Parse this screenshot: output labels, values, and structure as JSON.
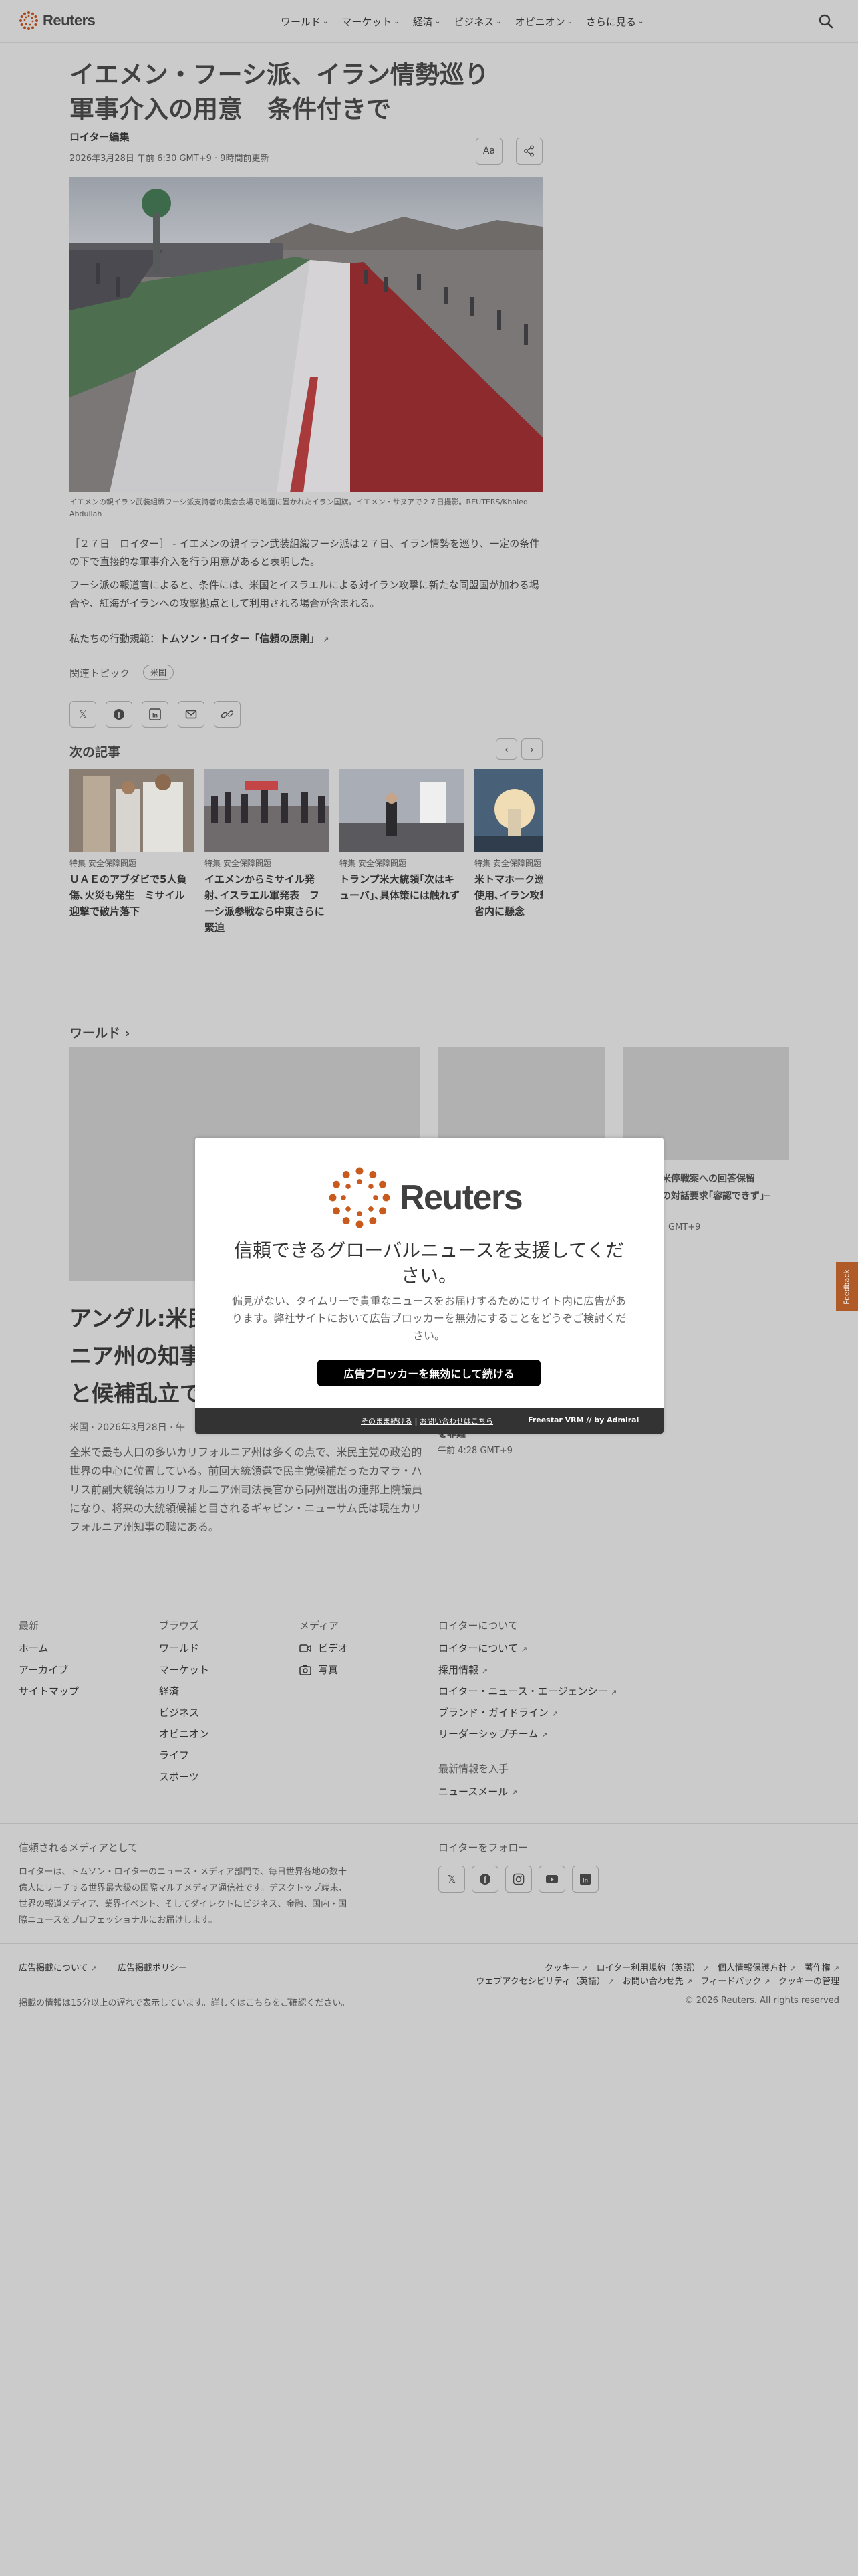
{
  "header": {
    "logo_text": "Reuters",
    "nav": [
      "ワールド",
      "マーケット",
      "経済",
      "ビジネス",
      "オピニオン",
      "さらに見る"
    ]
  },
  "article": {
    "headline_line1": "イエメン・フーシ派、イラン情勢巡り",
    "headline_line2": "軍事介入の用意　条件付きで",
    "byline": "ロイター編集",
    "dateline": "2026年3月28日 午前 6:30 GMT+9 · 9時間前更新",
    "text_size_button": "Aa",
    "caption": "イエメンの親イラン武装組織フーシ派支持者の集会会場で地面に置かれたイラン国旗。イエメン・サヌアで２７日撮影。REUTERS/Khaled Abdullah",
    "paragraph1": "［２７日　ロイター］ - イエメンの親イラン武装組織フーシ派は２７日、イラン情勢を巡り、一定の条件の下で直接的な軍事介入を行う用意があると表明した。",
    "paragraph2": "フーシ派の報道官によると、条件には、米国とイスラエルによる対イラン攻撃に新たな同盟国が加わる場合や、紅海がイランへの攻撃拠点として利用される場合が含まれる。",
    "ethics_prefix": "私たちの行動規範：",
    "ethics_link": "トムソン・ロイター「信頼の原則」",
    "topics_label": "関連トピック",
    "topic": "米国"
  },
  "next_articles": {
    "title": "次の記事",
    "cards": [
      {
        "kicker": "特集 安全保障問題",
        "title": "ＵＡＥのアブダビで5人負傷､火災も発生　ミサイル迎撃で破片落下"
      },
      {
        "kicker": "特集 安全保障問題",
        "title": "イエメンからミサイル発射､イスラエル軍発表　フーシ派参戦なら中東さらに緊迫"
      },
      {
        "kicker": "特集 安全保障問題",
        "title": "トランプ米大統領｢次はキューバ｣､具体策には触れず"
      },
      {
        "kicker": "特集 安全保障問題",
        "title": "米トマホーク巡航ミサイル使用､イラン攻撃で国防総省内に懸念"
      }
    ]
  },
  "world_section": {
    "label": "ワールド",
    "big_headline_visible": [
      "アングル:米民",
      "ニア州の知事",
      "と候補乱立で"
    ],
    "big_meta": "米国 · 2026年3月28日 · 午",
    "big_body": "全米で最も人口の多いカリフォルニア州は多くの点で、米民主党の政治的世界の中心に位置している。前回大統領選で民主党候補だったカマラ・ハリス前副大統領はカリフォルニア州司法長官から同州選出の連邦上院議員になり、将来の大統領候補と目されるギャビン・ニューサム氏は現在カリフォルニア州知事の職にある。",
    "side_title_1": "米停戦案への回答保留",
    "side_title_2": "の対話要求｢容認できず｣─",
    "side_time_1": "GMT+9",
    "side_word": "を非難",
    "side_time_2": "午前 4:28 GMT+9"
  },
  "modal": {
    "logo_text": "Reuters",
    "title": "信頼できるグローバルニュースを支援してください。",
    "body": "偏見がない、タイムリーで貴重なニュースをお届けするためにサイト内に広告があります。弊社サイトにおいて広告ブロッカーを無効にすることをどうぞご検討ください。",
    "cta": "広告ブロッカーを無効にして続ける",
    "foot_link1": "そのまま続ける",
    "foot_sep": "|",
    "foot_link2": "お問い合わせはこちら",
    "foot_brand": "Freestar VRM // by Admiral"
  },
  "feedback": "Feedback",
  "footer": {
    "col1": {
      "head": "最新",
      "links": [
        "ホーム",
        "アーカイブ",
        "サイトマップ"
      ]
    },
    "col2": {
      "head": "ブラウズ",
      "links": [
        "ワールド",
        "マーケット",
        "経済",
        "ビジネス",
        "オピニオン",
        "ライフ",
        "スポーツ"
      ]
    },
    "col3": {
      "head": "メディア",
      "links": [
        "ビデオ",
        "写真"
      ]
    },
    "col4": {
      "head": "ロイターについて",
      "links": [
        "ロイターについて",
        "採用情報",
        "ロイター・ニュース・エージェンシー",
        "ブランド・ガイドライン",
        "リーダーシップチーム"
      ]
    },
    "latest_head": "最新情報を入手",
    "newsletter": "ニュースメール",
    "trust_head": "信頼されるメディアとして",
    "trust_body": "ロイターは、トムソン・ロイターのニュース・メディア部門で、毎日世界各地の数十億人にリーチする世界最大級の国際マルチメディア通信社です。デスクトップ端末、世界の報道メディア、業界イベント、そしてダイレクトにビジネス、金融、国内・国際ニュースをプロフェッショナルにお届けします。",
    "follow_head": "ロイターをフォロー",
    "bottom_left": [
      "広告掲載について",
      "広告掲載ポリシー"
    ],
    "bottom_right_row1": [
      "クッキー",
      "ロイター利用規約（英語）",
      "個人情報保護方針",
      "著作権"
    ],
    "bottom_right_row2": [
      "ウェブアクセシビリティ（英語）",
      "お問い合わせ先",
      "フィードバック",
      "クッキーの管理"
    ],
    "delay_note": "掲載の情報は15分以上の遅れで表示しています。詳しくはこちらをご確認ください。",
    "copyright": "© 2026 Reuters. All rights reserved"
  }
}
